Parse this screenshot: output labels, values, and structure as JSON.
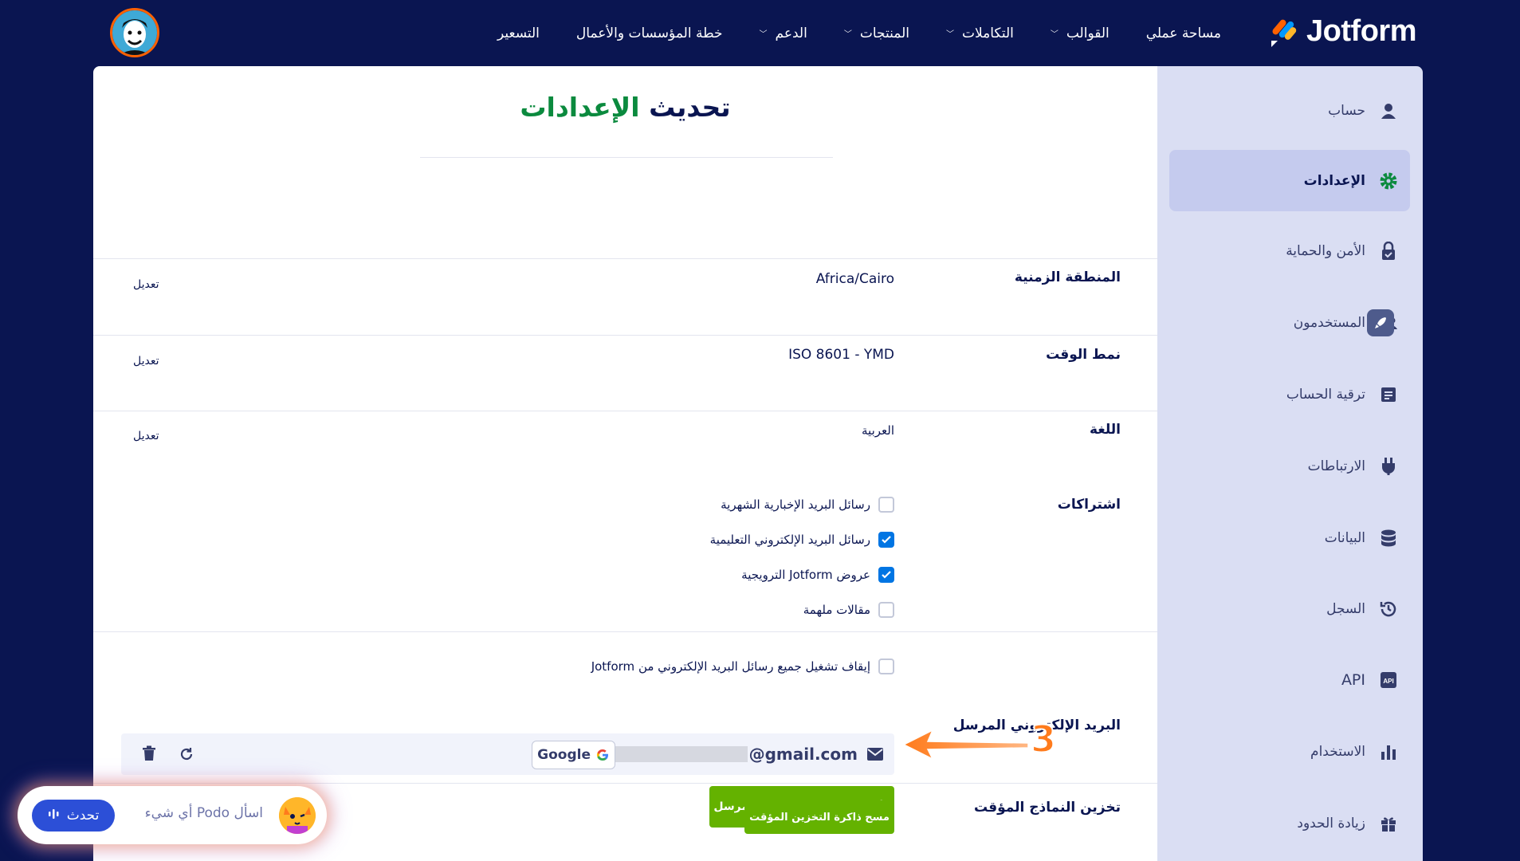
{
  "app": {
    "brand": "Jotform"
  },
  "nav": {
    "items": [
      {
        "label": "مساحة عملي",
        "has_dropdown": false
      },
      {
        "label": "القوالب",
        "has_dropdown": true
      },
      {
        "label": "التكاملات",
        "has_dropdown": true
      },
      {
        "label": "المنتجات",
        "has_dropdown": true
      },
      {
        "label": "الدعم",
        "has_dropdown": true
      },
      {
        "label": "خطة المؤسسات والأعمال",
        "has_dropdown": false
      },
      {
        "label": "التسعير",
        "has_dropdown": false
      }
    ]
  },
  "sidebar": {
    "items": [
      {
        "label": "حساب",
        "icon": "user-icon",
        "active": false
      },
      {
        "label": "الإعدادات",
        "icon": "gear-icon",
        "active": true
      },
      {
        "label": "الأمن والحماية",
        "icon": "lock-icon",
        "active": false
      },
      {
        "label": "المستخدمون",
        "icon": "users-icon",
        "active": false
      },
      {
        "label": "ترقية الحساب",
        "icon": "upgrade-icon",
        "active": false
      },
      {
        "label": "الارتباطات",
        "icon": "plug-icon",
        "active": false
      },
      {
        "label": "البيانات",
        "icon": "database-icon",
        "active": false
      },
      {
        "label": "السجل",
        "icon": "history-icon",
        "active": false
      },
      {
        "label": "API",
        "icon": "api-icon",
        "active": false
      },
      {
        "label": "الاستخدام",
        "icon": "bar-chart-icon",
        "active": false
      },
      {
        "label": "زيادة الحدود",
        "icon": "gift-icon",
        "active": false
      }
    ]
  },
  "main": {
    "title_part1": "تحديث",
    "title_part2": "الإعدادات",
    "edit_label": "تعديل",
    "timezone": {
      "label": "المنطقة الزمنية",
      "value": "Africa/Cairo"
    },
    "time_format": {
      "label": "نمط الوقت",
      "value": "ISO 8601 - YMD"
    },
    "language": {
      "label": "اللغة",
      "value": "العربية"
    },
    "subscriptions": {
      "label": "اشتراكات",
      "items": [
        {
          "label": "رسائل البريد الإخبارية الشهرية",
          "checked": false
        },
        {
          "label": "رسائل البريد الإلكتروني التعليمية",
          "checked": true
        },
        {
          "label": "عروض Jotform الترويجية",
          "checked": true
        },
        {
          "label": "مقالات ملهمة",
          "checked": false
        }
      ],
      "unsubscribe_all": {
        "label": "إيقاف تشغيل جميع رسائل البريد الإلكتروني من Jotform",
        "checked": false
      }
    },
    "sender_email": {
      "label": "البريد الإلكتروني المرسل",
      "email_suffix": "@gmail.com",
      "provider": "Google",
      "add_button": "إضافة بريد إلكتروني مرسل"
    },
    "form_cache": {
      "label": "تخزين النماذج المؤقت",
      "clear_button": "مسح ذاكرة التخزين المؤقت"
    }
  },
  "annotation": {
    "step": "3",
    "color": "#ff7b1c"
  },
  "podo": {
    "placeholder": "اسأل Podo أي شيء",
    "talk_button": "تحدث"
  }
}
